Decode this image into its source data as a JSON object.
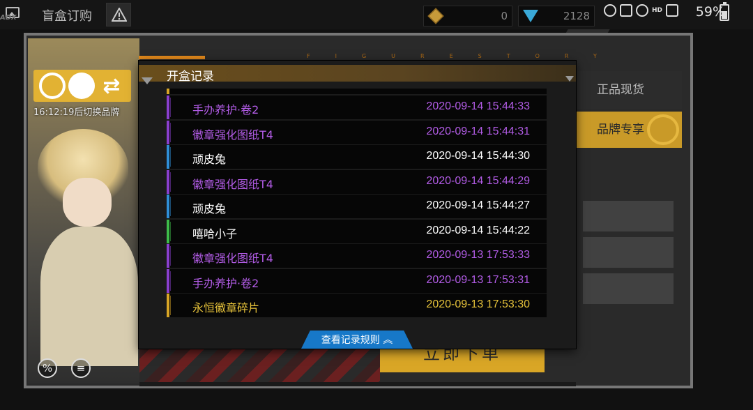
{
  "app": {
    "title": "盲盒订购",
    "brand_logo_text": "ADX"
  },
  "status_bar": {
    "gold_value": "0",
    "gem_value": "2128",
    "hd_label": "HD",
    "battery": "59%"
  },
  "brand_card": {
    "switch_countdown": "16:12:19后切换品牌"
  },
  "side_tabs": {
    "real_goods": "正品现货",
    "brand_exclusive": "品牌专享"
  },
  "order_button": "立即下单",
  "dialog": {
    "title": "开盒记录",
    "decor_letters": "FIGURESTORY",
    "rule_button": "查看记录规则",
    "records": [
      {
        "name": "手办养护·卷2",
        "time": "2020-09-14 15:44:33",
        "rarity_color": "#b25ce6"
      },
      {
        "name": "徽章强化图纸T4",
        "time": "2020-09-14 15:44:31",
        "rarity_color": "#b25ce6"
      },
      {
        "name": "顽皮兔",
        "time": "2020-09-14 15:44:30",
        "rarity_color": "#ffffff"
      },
      {
        "name": "徽章强化图纸T4",
        "time": "2020-09-14 15:44:29",
        "rarity_color": "#b25ce6"
      },
      {
        "name": "顽皮兔",
        "time": "2020-09-14 15:44:27",
        "rarity_color": "#ffffff"
      },
      {
        "name": "嘻哈小子",
        "time": "2020-09-14 15:44:22",
        "rarity_color": "#ffffff"
      },
      {
        "name": "徽章强化图纸T4",
        "time": "2020-09-13 17:53:33",
        "rarity_color": "#b25ce6"
      },
      {
        "name": "手办养护·卷2",
        "time": "2020-09-13 17:53:31",
        "rarity_color": "#b25ce6"
      },
      {
        "name": "永恒徽章碎片",
        "time": "2020-09-13 17:53:30",
        "rarity_color": "#e6c23a"
      }
    ],
    "bar_colors": [
      "#8a3fcf",
      "#8a3fcf",
      "#2f8fd8",
      "#8a3fcf",
      "#2f8fd8",
      "#3ebd4a",
      "#8a3fcf",
      "#8a3fcf",
      "#d9a626"
    ]
  }
}
